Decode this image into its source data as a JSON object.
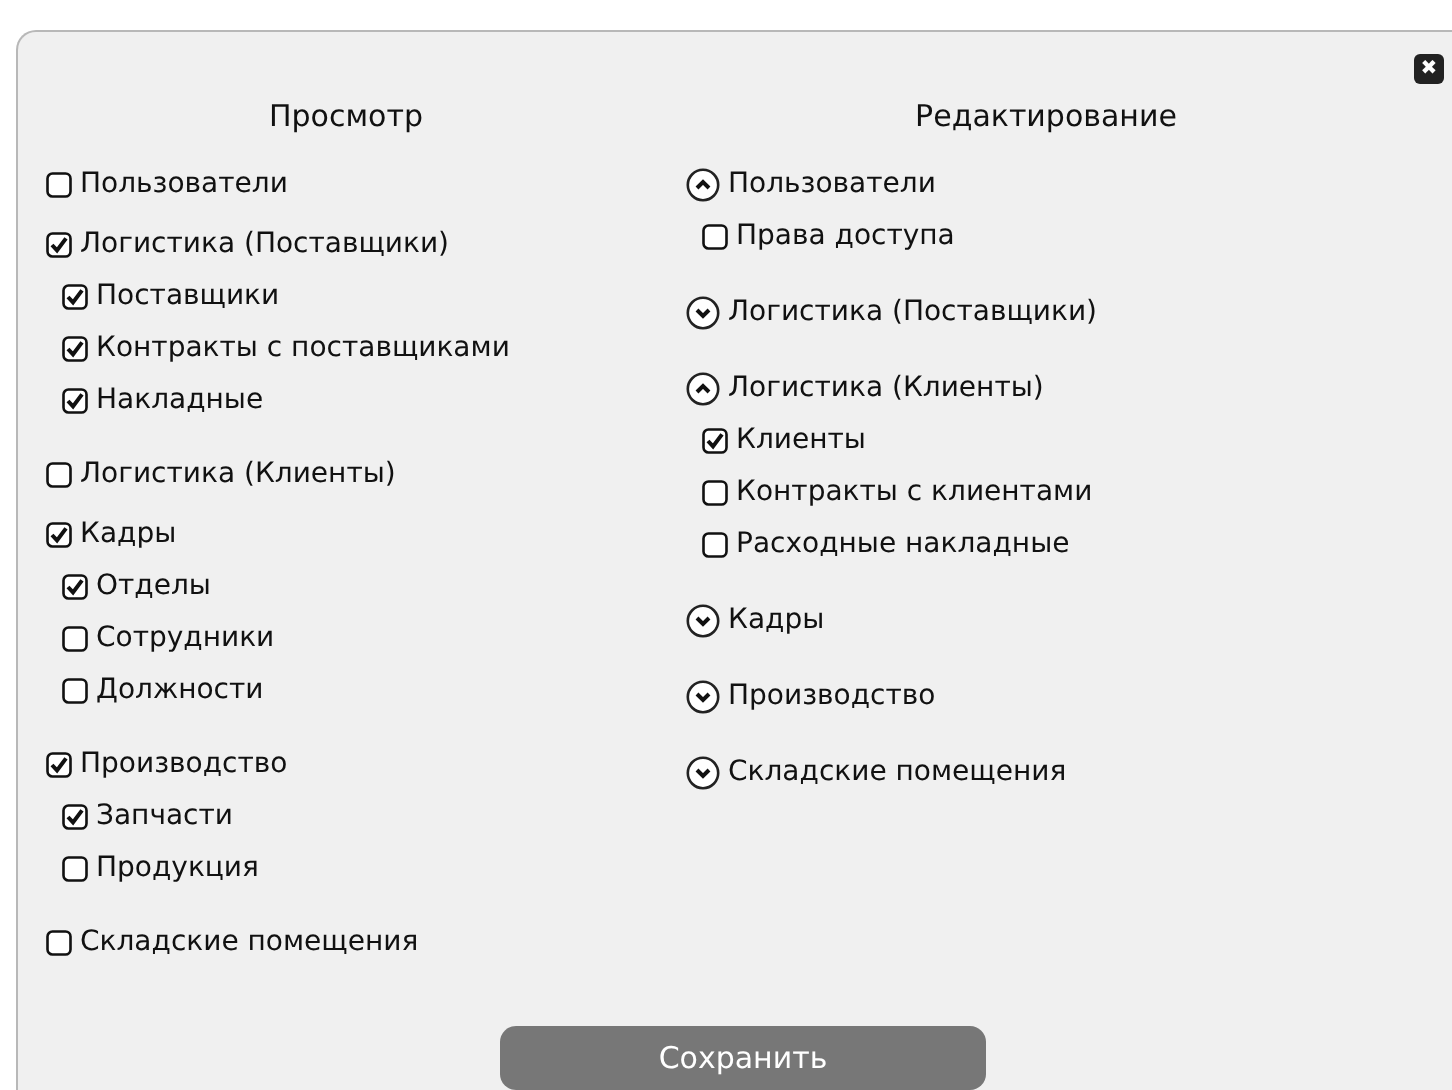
{
  "close_button": {
    "label": "✖"
  },
  "view": {
    "title": "Просмотр",
    "groups": [
      {
        "label": "Пользователи",
        "checked": false
      },
      {
        "label": "Логистика (Поставщики)",
        "checked": true,
        "children": [
          {
            "label": "Поставщики",
            "checked": true
          },
          {
            "label": "Контракты с поставщиками",
            "checked": true
          },
          {
            "label": "Накладные",
            "checked": true
          }
        ]
      },
      {
        "label": "Логистика (Клиенты)",
        "checked": false
      },
      {
        "label": "Кадры",
        "checked": true,
        "children": [
          {
            "label": "Отделы",
            "checked": true
          },
          {
            "label": "Сотрудники",
            "checked": false
          },
          {
            "label": "Должности",
            "checked": false
          }
        ]
      },
      {
        "label": "Производство",
        "checked": true,
        "children": [
          {
            "label": "Запчасти",
            "checked": true
          },
          {
            "label": "Продукция",
            "checked": false
          }
        ]
      },
      {
        "label": "Складские помещения",
        "checked": false
      }
    ]
  },
  "edit": {
    "title": "Редактирование",
    "groups": [
      {
        "label": "Пользователи",
        "expanded": true,
        "children": [
          {
            "label": "Права доступа",
            "checked": false
          }
        ]
      },
      {
        "label": "Логистика (Поставщики)",
        "expanded": false
      },
      {
        "label": "Логистика (Клиенты)",
        "expanded": true,
        "children": [
          {
            "label": "Клиенты",
            "checked": true
          },
          {
            "label": "Контракты с клиентами",
            "checked": false
          },
          {
            "label": "Расходные накладные",
            "checked": false
          }
        ]
      },
      {
        "label": "Кадры",
        "expanded": false
      },
      {
        "label": "Производство",
        "expanded": false
      },
      {
        "label": "Складские помещения",
        "expanded": false
      }
    ]
  },
  "save_button": {
    "label": "Сохранить"
  }
}
